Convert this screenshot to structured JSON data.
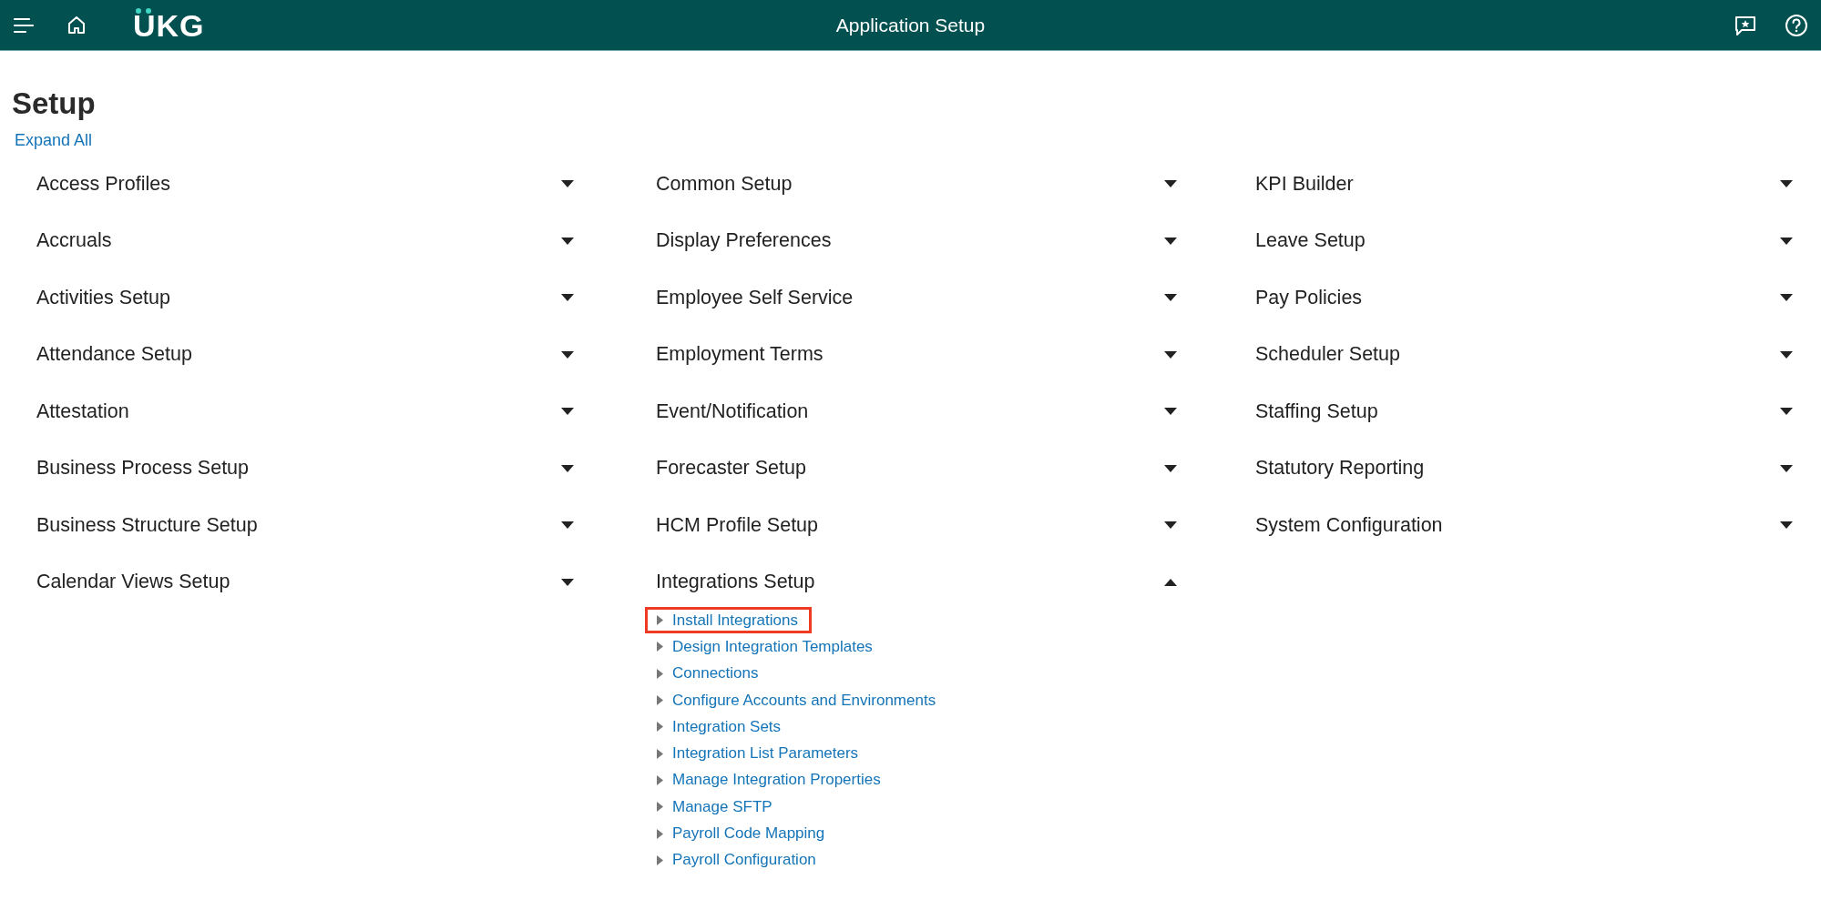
{
  "header": {
    "logo": "UKG",
    "title": "Application Setup"
  },
  "page": {
    "title": "Setup",
    "expand_all": "Expand All"
  },
  "columns": [
    {
      "sections": [
        {
          "label": "Access Profiles",
          "expanded": false
        },
        {
          "label": "Accruals",
          "expanded": false
        },
        {
          "label": "Activities Setup",
          "expanded": false
        },
        {
          "label": "Attendance Setup",
          "expanded": false
        },
        {
          "label": "Attestation",
          "expanded": false
        },
        {
          "label": "Business Process Setup",
          "expanded": false
        },
        {
          "label": "Business Structure Setup",
          "expanded": false
        },
        {
          "label": "Calendar Views Setup",
          "expanded": false
        }
      ]
    },
    {
      "sections": [
        {
          "label": "Common Setup",
          "expanded": false
        },
        {
          "label": "Display Preferences",
          "expanded": false
        },
        {
          "label": "Employee Self Service",
          "expanded": false
        },
        {
          "label": "Employment Terms",
          "expanded": false
        },
        {
          "label": "Event/Notification",
          "expanded": false
        },
        {
          "label": "Forecaster Setup",
          "expanded": false
        },
        {
          "label": "HCM Profile Setup",
          "expanded": false
        },
        {
          "label": "Integrations Setup",
          "expanded": true,
          "children": [
            {
              "label": "Install Integrations",
              "highlighted": true
            },
            {
              "label": "Design Integration Templates",
              "highlighted": false
            },
            {
              "label": "Connections",
              "highlighted": false
            },
            {
              "label": "Configure Accounts and Environments",
              "highlighted": false
            },
            {
              "label": "Integration Sets",
              "highlighted": false
            },
            {
              "label": "Integration List Parameters",
              "highlighted": false
            },
            {
              "label": "Manage Integration Properties",
              "highlighted": false
            },
            {
              "label": "Manage SFTP",
              "highlighted": false
            },
            {
              "label": "Payroll Code Mapping",
              "highlighted": false
            },
            {
              "label": "Payroll Configuration",
              "highlighted": false
            }
          ]
        }
      ]
    },
    {
      "sections": [
        {
          "label": "KPI Builder",
          "expanded": false
        },
        {
          "label": "Leave Setup",
          "expanded": false
        },
        {
          "label": "Pay Policies",
          "expanded": false
        },
        {
          "label": "Scheduler Setup",
          "expanded": false
        },
        {
          "label": "Staffing Setup",
          "expanded": false
        },
        {
          "label": "Statutory Reporting",
          "expanded": false
        },
        {
          "label": "System Configuration",
          "expanded": false
        }
      ]
    }
  ]
}
